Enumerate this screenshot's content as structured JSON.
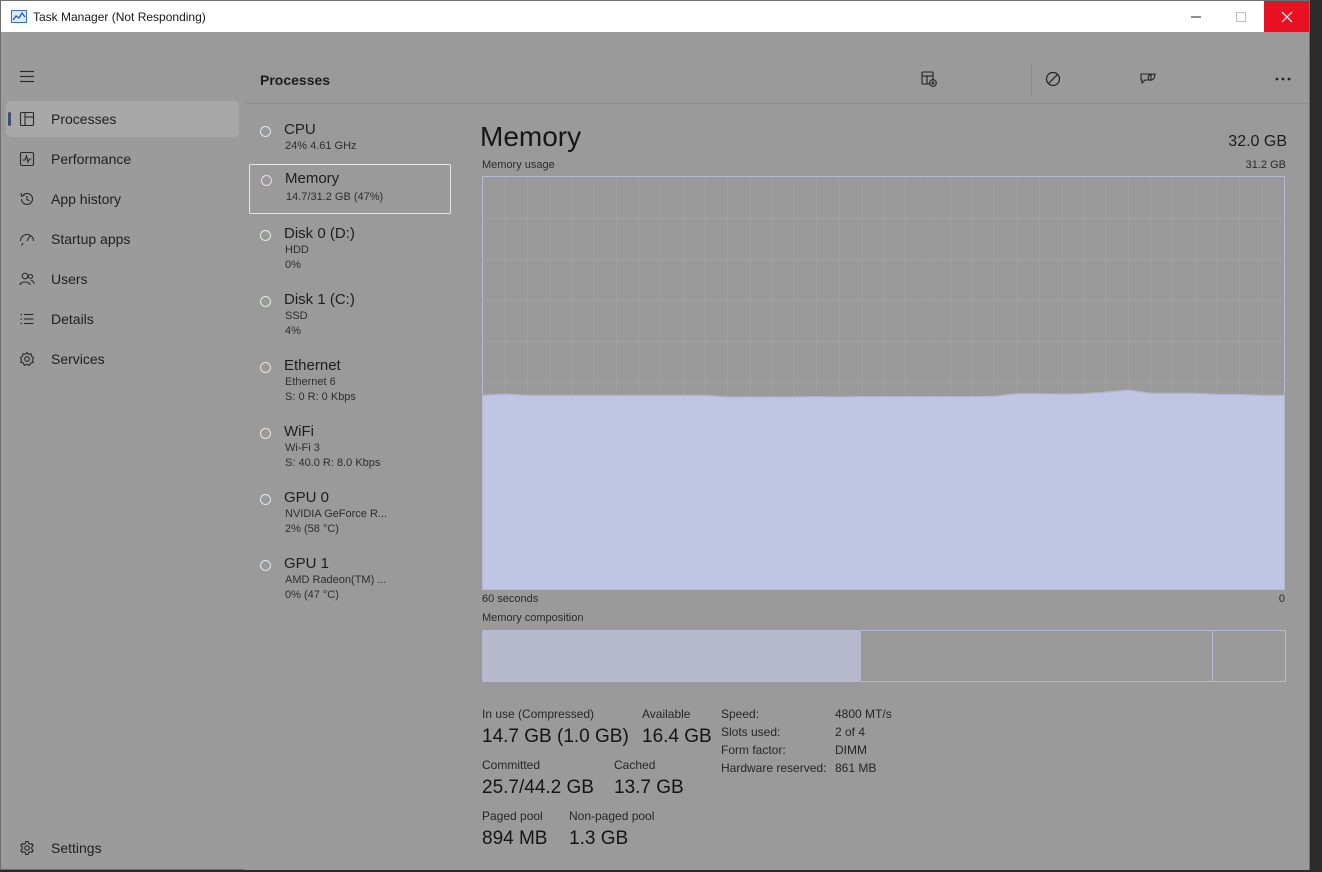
{
  "window": {
    "title": "Task Manager (Not Responding)",
    "close_color": "#e81123"
  },
  "sidebar": {
    "items": [
      {
        "label": "Processes",
        "icon": "processes-icon",
        "active": true
      },
      {
        "label": "Performance",
        "icon": "performance-icon"
      },
      {
        "label": "App history",
        "icon": "app-history-icon"
      },
      {
        "label": "Startup apps",
        "icon": "startup-apps-icon"
      },
      {
        "label": "Users",
        "icon": "users-icon"
      },
      {
        "label": "Details",
        "icon": "details-icon"
      },
      {
        "label": "Services",
        "icon": "services-icon"
      }
    ],
    "settings_label": "Settings"
  },
  "header": {
    "title": "Processes",
    "actions": [
      "run-new-task-icon",
      "end-task-icon",
      "efficiency-mode-icon",
      "more-options-icon"
    ]
  },
  "resources": [
    {
      "name": "CPU",
      "line1": "24%  4.61 GHz",
      "line2": ""
    },
    {
      "name": "Memory",
      "line1": "14.7/31.2 GB (47%)",
      "line2": "",
      "selected": true
    },
    {
      "name": "Disk 0 (D:)",
      "line1": "HDD",
      "line2": "0%"
    },
    {
      "name": "Disk 1 (C:)",
      "line1": "SSD",
      "line2": "4%"
    },
    {
      "name": "Ethernet",
      "line1": "Ethernet 6",
      "line2": "S: 0  R: 0 Kbps"
    },
    {
      "name": "WiFi",
      "line1": "Wi-Fi 3",
      "line2": "S: 40.0  R: 8.0 Kbps"
    },
    {
      "name": "GPU 0",
      "line1": "NVIDIA GeForce R...",
      "line2": "2%  (58 °C)"
    },
    {
      "name": "GPU 1",
      "line1": "AMD Radeon(TM) ...",
      "line2": "0%  (47 °C)"
    }
  ],
  "detail": {
    "title": "Memory",
    "total": "32.0 GB",
    "usage_label": "Memory usage",
    "usage_max": "31.2 GB",
    "time_left": "60 seconds",
    "time_right": "0",
    "usage_fraction": 0.47,
    "composition_label": "Memory composition",
    "composition": {
      "in_use": 14.7,
      "modified": 0.0,
      "standby": 13.7,
      "free": 2.8,
      "total": 31.2
    },
    "stats": [
      {
        "label": "In use (Compressed)",
        "value": "14.7 GB (1.0 GB)"
      },
      {
        "label": "Available",
        "value": "16.4 GB"
      },
      {
        "label": "Committed",
        "value": "25.7/44.2 GB"
      },
      {
        "label": "Cached",
        "value": "13.7 GB"
      },
      {
        "label": "Paged pool",
        "value": "894 MB"
      },
      {
        "label": "Non-paged pool",
        "value": "1.3 GB"
      }
    ],
    "specs": [
      {
        "label": "Speed:",
        "value": "4800 MT/s"
      },
      {
        "label": "Slots used:",
        "value": "2 of 4"
      },
      {
        "label": "Form factor:",
        "value": "DIMM"
      },
      {
        "label": "Hardware reserved:",
        "value": "861 MB"
      }
    ],
    "graph_color": "#bfc5e3",
    "graph_border": "#b4b8d3"
  }
}
